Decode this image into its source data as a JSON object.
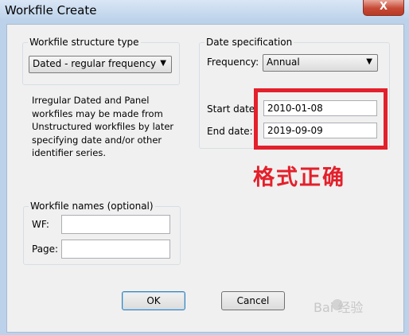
{
  "window": {
    "title": "Workfile Create",
    "close_glyph": "X"
  },
  "structure": {
    "legend": "Workfile structure type",
    "selected": "Dated - regular frequency",
    "info": "Irregular Dated and Panel workfiles may be made from Unstructured workfiles by later specifying date and/or other identifier series."
  },
  "date_spec": {
    "legend": "Date specification",
    "frequency_label": "Frequency:",
    "frequency_value": "Annual",
    "start_label": "Start date",
    "start_value": "2010-01-08",
    "end_label": "End date:",
    "end_value": "2019-09-09"
  },
  "names": {
    "legend": "Workfile names (optional)",
    "wf_label": "WF:",
    "wf_value": "",
    "page_label": "Page:",
    "page_value": ""
  },
  "buttons": {
    "ok": "OK",
    "cancel": "Cancel"
  },
  "annotation": {
    "text": "格式正确",
    "color": "#e3202b"
  },
  "watermark": {
    "text": "Bai 经验"
  }
}
